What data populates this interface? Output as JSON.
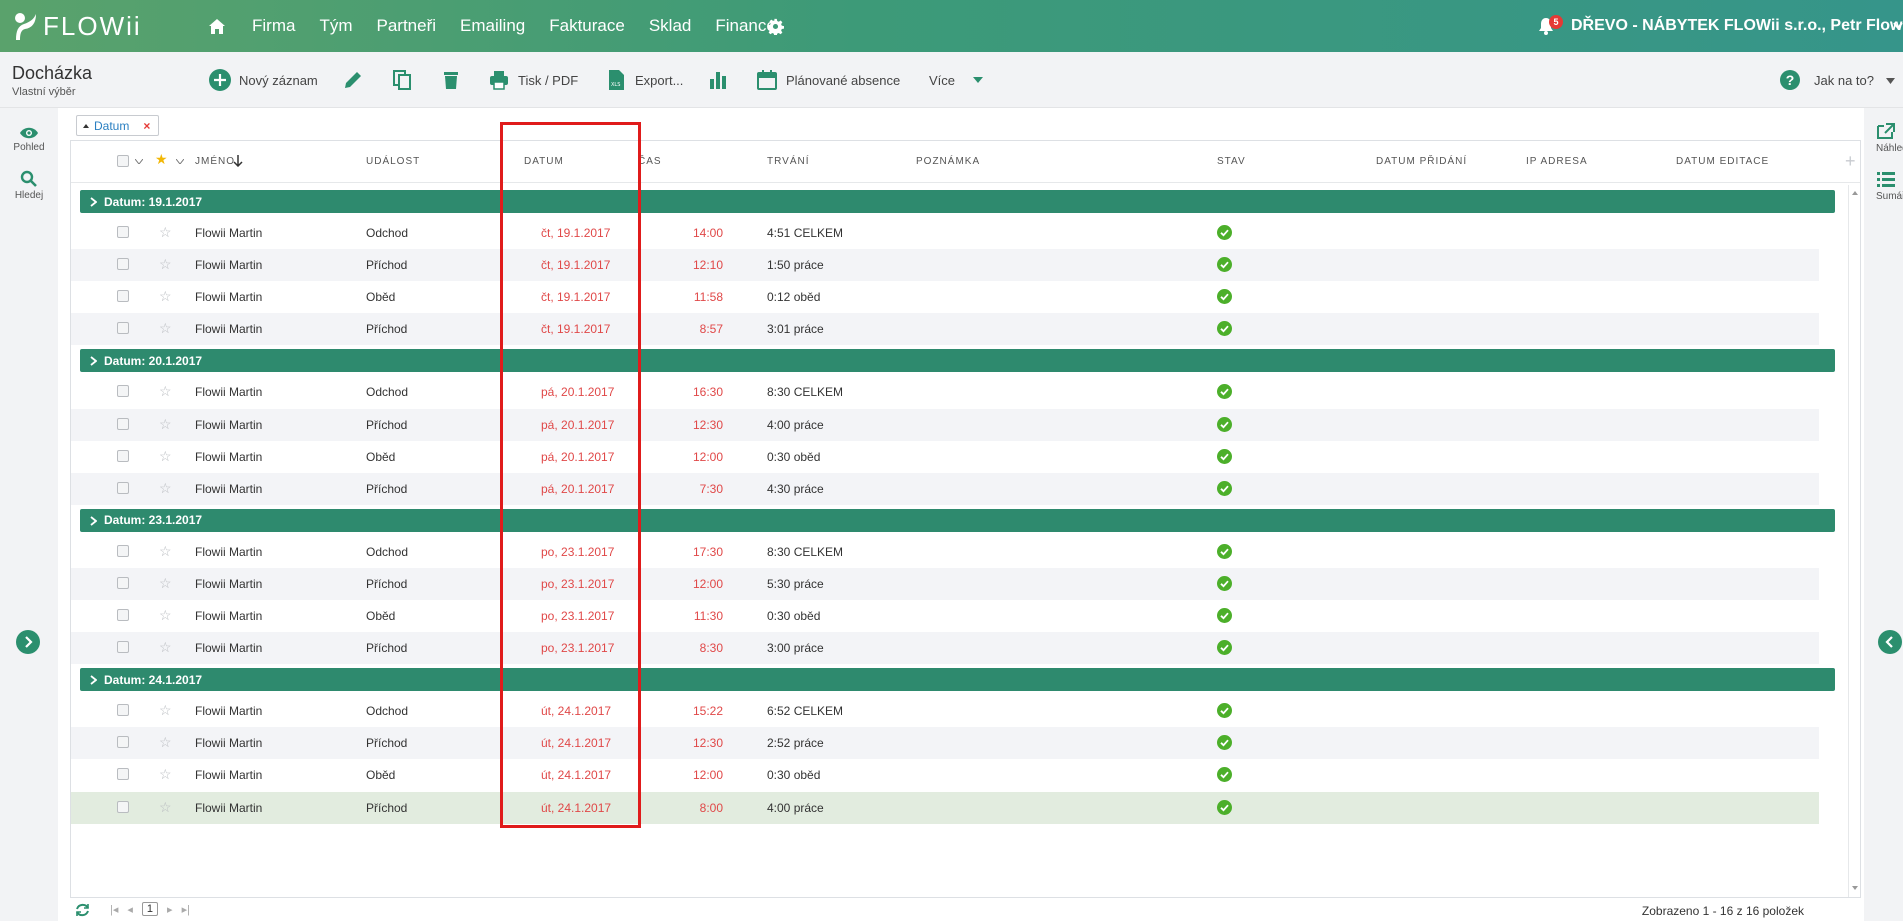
{
  "app": {
    "logo_text": "FLOWii",
    "nav": [
      "Firma",
      "Tým",
      "Partneři",
      "Emailing",
      "Fakturace",
      "Sklad",
      "Finance"
    ],
    "notifications_count": "5",
    "company": "DŘEVO - NÁBYTEK FLOWii s.r.o., Petr Flowii"
  },
  "toolbar": {
    "title": "Docházka",
    "subtitle": "Vlastní výběr",
    "new_record": "Nový záznam",
    "print": "Tisk / PDF",
    "export": "Export...",
    "planned_absence": "Plánované absence",
    "more": "Více",
    "help": "Jak na to?"
  },
  "left_rail": {
    "view": "Pohled",
    "search": "Hledej"
  },
  "right_rail": {
    "preview": "Náhled",
    "summary": "Sumář"
  },
  "filter_chip": {
    "label": "Datum"
  },
  "columns": {
    "name": "JMÉNO",
    "event": "UDÁLOST",
    "date": "DATUM",
    "time": "ČAS",
    "duration": "TRVÁNÍ",
    "note": "POZNÁMKA",
    "status": "STAV",
    "date_added": "DATUM PŘIDÁNÍ",
    "ip": "IP ADRESA",
    "date_edited": "DATUM EDITACE"
  },
  "groups": [
    {
      "label": "Datum: 19.1.2017",
      "rows": [
        {
          "name": "Flowii Martin",
          "event": "Odchod",
          "date": "čt, 19.1.2017",
          "time": "14:00",
          "duration": "4:51 CELKEM"
        },
        {
          "name": "Flowii Martin",
          "event": "Příchod",
          "date": "čt, 19.1.2017",
          "time": "12:10",
          "duration": "1:50 práce"
        },
        {
          "name": "Flowii Martin",
          "event": "Oběd",
          "date": "čt, 19.1.2017",
          "time": "11:58",
          "duration": "0:12 oběd"
        },
        {
          "name": "Flowii Martin",
          "event": "Příchod",
          "date": "čt, 19.1.2017",
          "time": "8:57",
          "duration": "3:01 práce"
        }
      ]
    },
    {
      "label": "Datum: 20.1.2017",
      "rows": [
        {
          "name": "Flowii Martin",
          "event": "Odchod",
          "date": "pá, 20.1.2017",
          "time": "16:30",
          "duration": "8:30 CELKEM"
        },
        {
          "name": "Flowii Martin",
          "event": "Příchod",
          "date": "pá, 20.1.2017",
          "time": "12:30",
          "duration": "4:00 práce"
        },
        {
          "name": "Flowii Martin",
          "event": "Oběd",
          "date": "pá, 20.1.2017",
          "time": "12:00",
          "duration": "0:30 oběd"
        },
        {
          "name": "Flowii Martin",
          "event": "Příchod",
          "date": "pá, 20.1.2017",
          "time": "7:30",
          "duration": "4:30 práce"
        }
      ]
    },
    {
      "label": "Datum: 23.1.2017",
      "rows": [
        {
          "name": "Flowii Martin",
          "event": "Odchod",
          "date": "po, 23.1.2017",
          "time": "17:30",
          "duration": "8:30 CELKEM"
        },
        {
          "name": "Flowii Martin",
          "event": "Příchod",
          "date": "po, 23.1.2017",
          "time": "12:00",
          "duration": "5:30 práce"
        },
        {
          "name": "Flowii Martin",
          "event": "Oběd",
          "date": "po, 23.1.2017",
          "time": "11:30",
          "duration": "0:30 oběd"
        },
        {
          "name": "Flowii Martin",
          "event": "Příchod",
          "date": "po, 23.1.2017",
          "time": "8:30",
          "duration": "3:00 práce"
        }
      ]
    },
    {
      "label": "Datum: 24.1.2017",
      "rows": [
        {
          "name": "Flowii Martin",
          "event": "Odchod",
          "date": "út, 24.1.2017",
          "time": "15:22",
          "duration": "6:52 CELKEM"
        },
        {
          "name": "Flowii Martin",
          "event": "Příchod",
          "date": "út, 24.1.2017",
          "time": "12:30",
          "duration": "2:52 práce"
        },
        {
          "name": "Flowii Martin",
          "event": "Oběd",
          "date": "út, 24.1.2017",
          "time": "12:00",
          "duration": "0:30 oběd"
        },
        {
          "name": "Flowii Martin",
          "event": "Příchod",
          "date": "út, 24.1.2017",
          "time": "8:00",
          "duration": "4:00 práce"
        }
      ]
    }
  ],
  "footer": {
    "page": "1",
    "status": "Zobrazeno 1 - 16 z 16 položek"
  }
}
